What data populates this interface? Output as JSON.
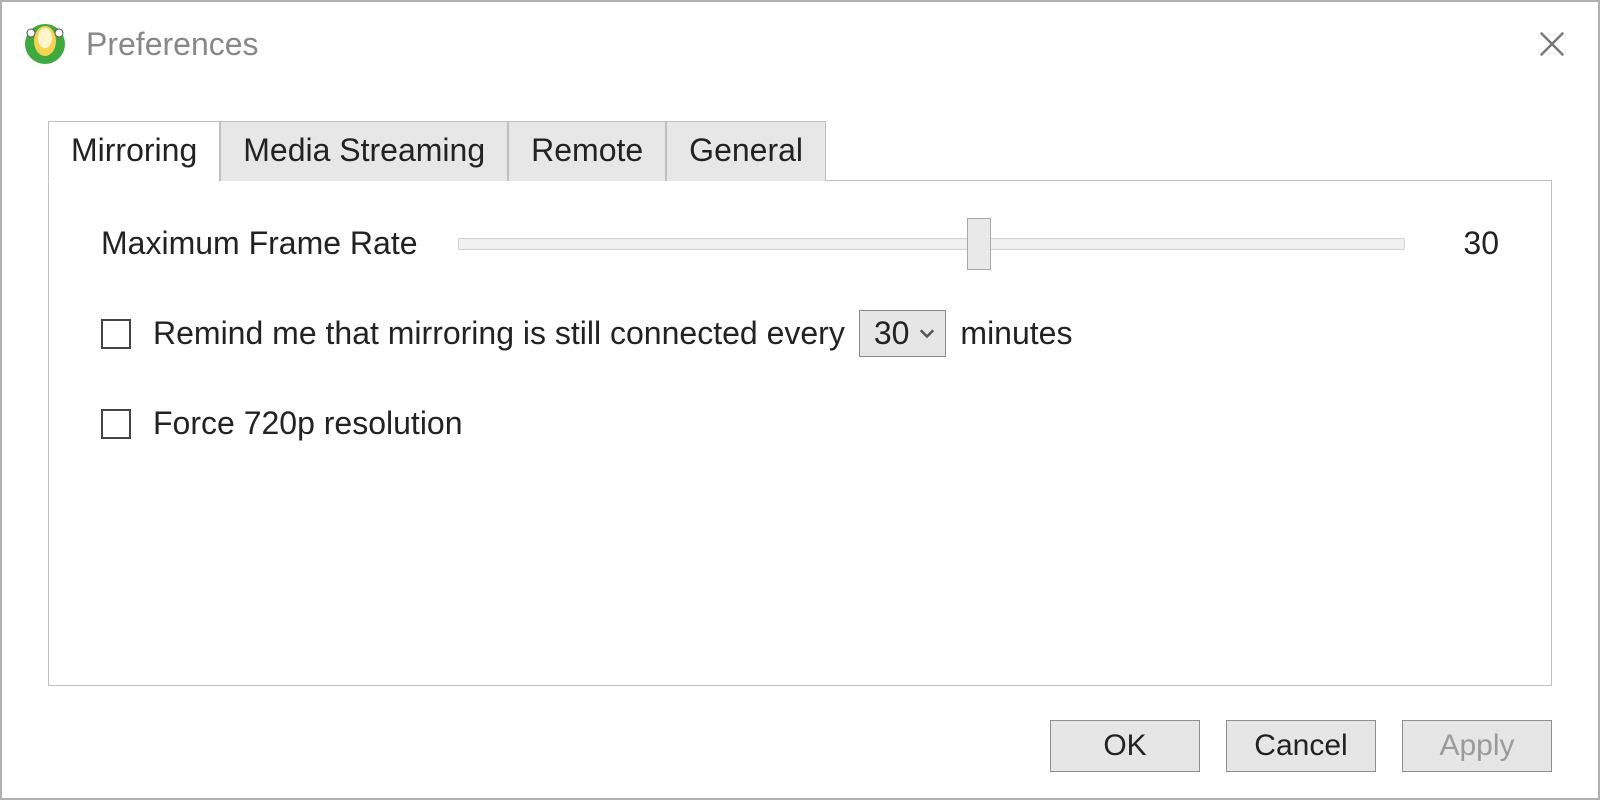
{
  "window": {
    "title": "Preferences"
  },
  "tabs": [
    {
      "label": "Mirroring",
      "active": true
    },
    {
      "label": "Media Streaming",
      "active": false
    },
    {
      "label": "Remote",
      "active": false
    },
    {
      "label": "General",
      "active": false
    }
  ],
  "mirroring": {
    "framerate_label": "Maximum Frame Rate",
    "framerate_value": "30",
    "remind_checked": false,
    "remind_text_before": "Remind me that mirroring is still connected every",
    "remind_interval_selected": "30",
    "remind_text_after": "minutes",
    "force720_checked": false,
    "force720_label": "Force 720p resolution"
  },
  "buttons": {
    "ok": "OK",
    "cancel": "Cancel",
    "apply": "Apply",
    "apply_enabled": false
  }
}
